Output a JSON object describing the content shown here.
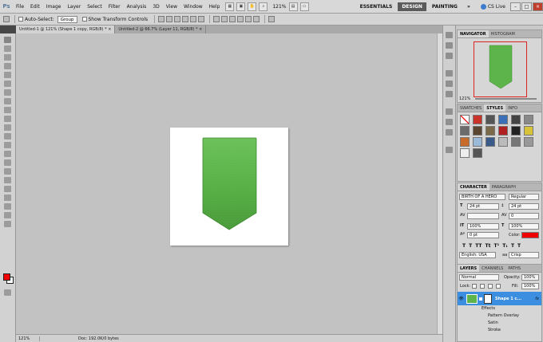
{
  "menubar": {
    "logo": "Ps",
    "items": [
      "File",
      "Edit",
      "Image",
      "Layer",
      "Select",
      "Filter",
      "Analysis",
      "3D",
      "View",
      "Window",
      "Help"
    ],
    "zoom": "121%",
    "workspaces": [
      "ESSENTIALS",
      "DESIGN",
      "PAINTING"
    ],
    "active_workspace": "DESIGN",
    "more": "»",
    "cs_live": "CS Live",
    "win_minimize": "–",
    "win_maximize": "□",
    "win_close": "×"
  },
  "options": {
    "auto_select_label": "Auto-Select:",
    "auto_select_value": "Group",
    "transform_label": "Show Transform Controls"
  },
  "tabs": [
    {
      "label": "Untitled-1 @ 121% (Shape 1 copy, RGB/8) *",
      "close": "×"
    },
    {
      "label": "Untitled-2 @ 66.7% (Layer 11, RGB/8) *",
      "close": "×"
    }
  ],
  "status": {
    "zoom": "121%",
    "doc": "Doc: 192.0K/0 bytes"
  },
  "navigator": {
    "tabs": [
      "NAVIGATOR",
      "HISTOGRAM"
    ],
    "zoom": "121%"
  },
  "styles_panel": {
    "tabs": [
      "SWATCHES",
      "STYLES",
      "INFO"
    ]
  },
  "character": {
    "tabs": [
      "CHARACTER",
      "PARAGRAPH"
    ],
    "font": "BIRTH OF A HERO",
    "style": "Regular",
    "size": "24 pt",
    "leading": "24 pt",
    "tracking": "0",
    "vscale": "100%",
    "hscale": "100%",
    "baseline": "0 pt",
    "color_label": "Color:",
    "color": "#ee0000",
    "language": "English: USA",
    "aa_prefix": "aa",
    "antialias": "Crisp"
  },
  "layers": {
    "tabs": [
      "LAYERS",
      "CHANNELS",
      "PATHS"
    ],
    "blend": "Normal",
    "opacity_label": "Opacity:",
    "opacity": "100%",
    "lock_label": "Lock:",
    "fill_label": "Fill:",
    "fill": "100%",
    "layer_name": "Shape 1 c...",
    "fx": "fx",
    "effects": [
      "Effects",
      "Pattern Overlay",
      "Satin",
      "Stroke"
    ]
  }
}
